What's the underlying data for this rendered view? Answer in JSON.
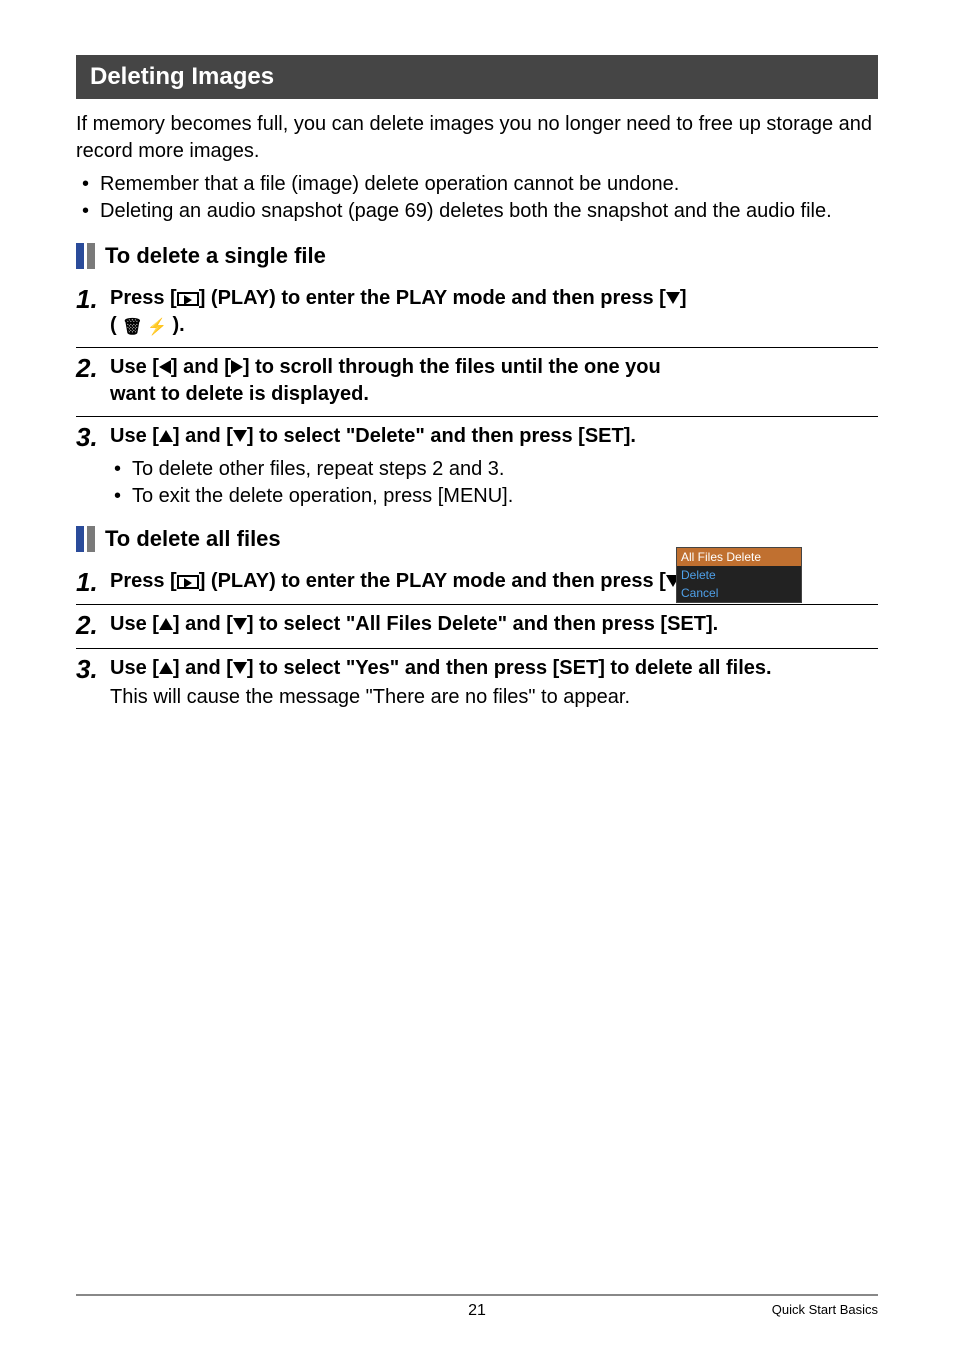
{
  "section_title": "Deleting Images",
  "intro": "If memory becomes full, you can delete images you no longer need to free up storage and record more images.",
  "intro_bullets": [
    "Remember that a file (image) delete operation cannot be undone.",
    "Deleting an audio snapshot (page 69) deletes both the snapshot and the audio file."
  ],
  "sub1_title": "To delete a single file",
  "sub1_steps": {
    "s1_pre": "Press [",
    "s1_mid1": "] (PLAY) to enter the PLAY mode and then press [",
    "s1_mid2": "] ( ",
    "s1_end": " ).",
    "s2_pre": "Use [",
    "s2_mid1": "] and [",
    "s2_mid2": "] to scroll through the files until the one you want to delete is displayed.",
    "s3_pre": "Use [",
    "s3_mid1": "] and [",
    "s3_mid2": "] to select \"Delete\" and then press [SET].",
    "s3_bullets": [
      "To delete other files, repeat steps 2 and 3.",
      "To exit the delete operation, press [MENU]."
    ]
  },
  "sub2_title": "To delete all files",
  "sub2_steps": {
    "s1_pre": "Press [",
    "s1_mid1": "] (PLAY) to enter the PLAY mode and then press [",
    "s1_mid2": "] ( ",
    "s1_end": " ).",
    "s2_pre": "Use [",
    "s2_mid1": "] and [",
    "s2_mid2": "] to select \"All Files Delete\" and then press [SET].",
    "s3_pre": "Use [",
    "s3_mid1": "] and [",
    "s3_mid2": "] to select \"Yes\" and then press [SET] to delete all files.",
    "s3_after": "This will cause the message \"There are no files\" to appear."
  },
  "screenshot": {
    "row1": "All Files Delete",
    "row2": "Delete",
    "row3": "Cancel"
  },
  "trash_flash_glyph": "🗑 ⚡",
  "footer": {
    "page": "21",
    "right": "Quick Start Basics"
  }
}
